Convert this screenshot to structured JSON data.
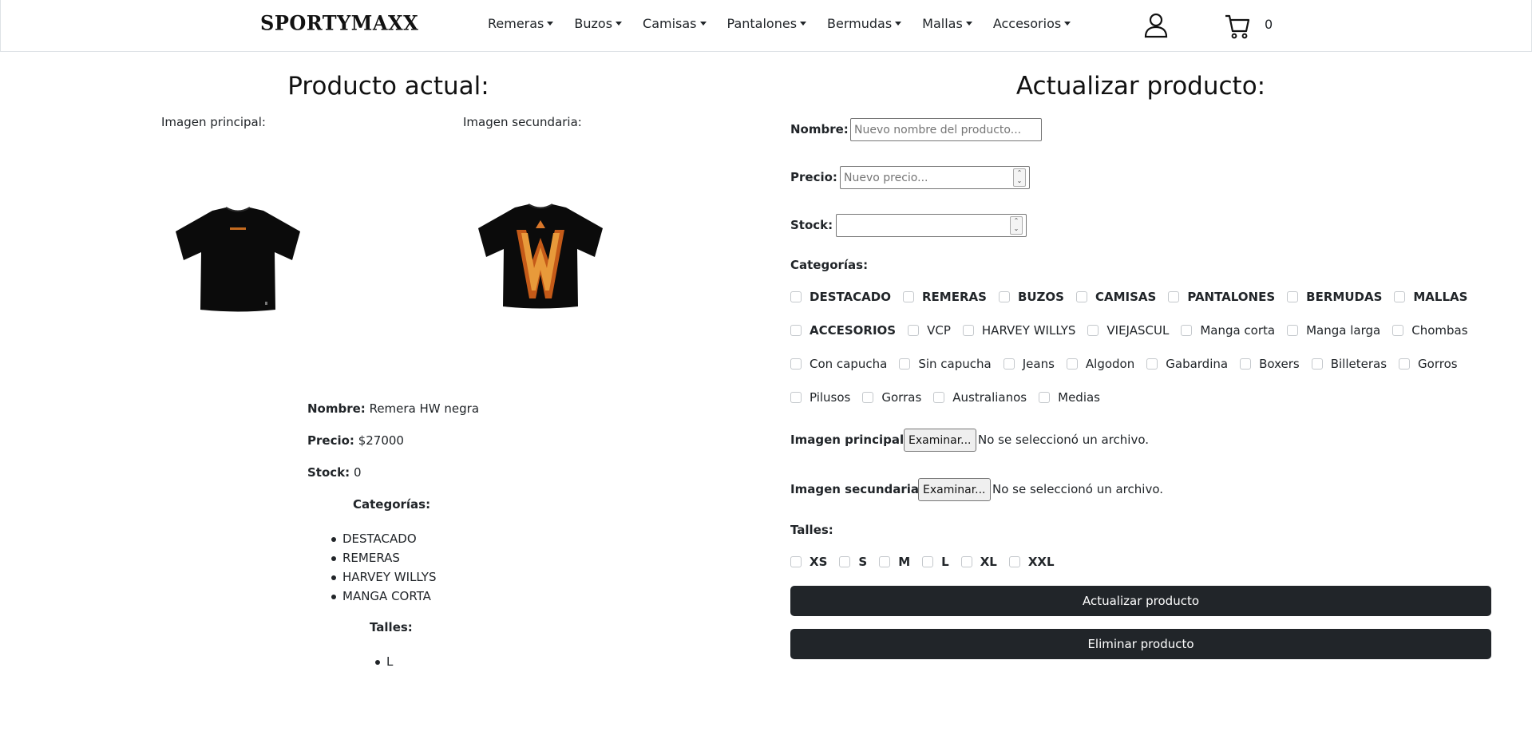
{
  "header": {
    "logo_text": "SPORTYMAXX",
    "nav_items": [
      "Remeras",
      "Buzos",
      "Camisas",
      "Pantalones",
      "Bermudas",
      "Mallas",
      "Accesorios"
    ],
    "cart_count": "0",
    "icons": {
      "user": "user-icon",
      "cart": "cart-icon"
    }
  },
  "current": {
    "title": "Producto actual:",
    "main_image_label": "Imagen principal:",
    "secondary_image_label": "Imagen secundaria:",
    "name_label": "Nombre:",
    "name_value": "Remera HW negra",
    "price_label": "Precio:",
    "price_value": "$27000",
    "stock_label": "Stock:",
    "stock_value": "0",
    "categories_title": "Categorías:",
    "categories": [
      "DESTACADO",
      "REMERAS",
      "HARVEY WILLYS",
      "MANGA CORTA"
    ],
    "sizes_title": "Talles:",
    "sizes": [
      "L"
    ]
  },
  "form": {
    "title": "Actualizar producto:",
    "name_label": "Nombre:",
    "name_placeholder": "Nuevo nombre del producto...",
    "price_label": "Precio:",
    "price_placeholder": "Nuevo precio...",
    "stock_label": "Stock:",
    "stock_value": "",
    "categories_label": "Categorías:",
    "category_rows": [
      [
        "DESTACADO",
        "REMERAS",
        "BUZOS",
        "CAMISAS",
        "PANTALONES",
        "BERMUDAS",
        "MALLAS"
      ],
      [
        "ACCESORIOS",
        "VCP",
        "HARVEY WILLYS",
        "VIEJASCUL",
        "Manga corta",
        "Manga larga",
        "Chombas"
      ],
      [
        "Con capucha",
        "Sin capucha",
        "Jeans",
        "Algodon",
        "Gabardina",
        "Boxers",
        "Billeteras",
        "Gorros"
      ],
      [
        "Pilusos",
        "Gorras",
        "Australianos",
        "Medias"
      ]
    ],
    "main_image_label": "Imagen principal:",
    "secondary_image_label": "Imagen secundaria:",
    "browse_label": "Examinar...",
    "no_file_text": "No se seleccionó un archivo.",
    "sizes_label": "Talles:",
    "sizes": [
      "XS",
      "S",
      "M",
      "L",
      "XL",
      "XXL"
    ],
    "update_button": "Actualizar producto",
    "delete_button": "Eliminar producto"
  }
}
